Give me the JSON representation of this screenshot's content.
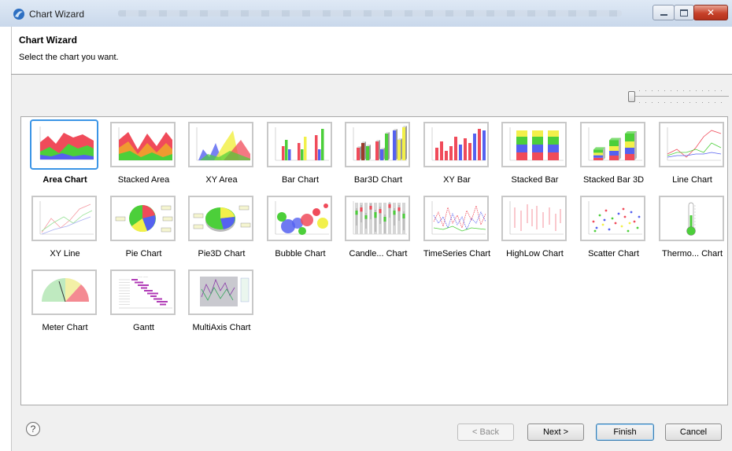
{
  "window": {
    "title": "Chart Wizard"
  },
  "header": {
    "title": "Chart Wizard",
    "subtitle": "Select the chart you want."
  },
  "charts": [
    {
      "label": "Area Chart",
      "selected": true,
      "icon": "area-chart-icon"
    },
    {
      "label": "Stacked Area",
      "icon": "stacked-area-icon"
    },
    {
      "label": "XY Area",
      "icon": "xy-area-icon"
    },
    {
      "label": "Bar Chart",
      "icon": "bar-chart-icon"
    },
    {
      "label": "Bar3D Chart",
      "icon": "bar3d-chart-icon"
    },
    {
      "label": "XY Bar",
      "icon": "xy-bar-icon"
    },
    {
      "label": "Stacked Bar",
      "icon": "stacked-bar-icon"
    },
    {
      "label": "Stacked Bar 3D",
      "icon": "stacked-bar-3d-icon"
    },
    {
      "label": "Line Chart",
      "icon": "line-chart-icon"
    },
    {
      "label": "XY Line",
      "icon": "xy-line-icon"
    },
    {
      "label": "Pie Chart",
      "icon": "pie-chart-icon"
    },
    {
      "label": "Pie3D Chart",
      "icon": "pie3d-chart-icon"
    },
    {
      "label": "Bubble Chart",
      "icon": "bubble-chart-icon"
    },
    {
      "label": "Candle... Chart",
      "icon": "candlestick-chart-icon"
    },
    {
      "label": "TimeSeries Chart",
      "icon": "timeseries-chart-icon"
    },
    {
      "label": "HighLow Chart",
      "icon": "highlow-chart-icon"
    },
    {
      "label": "Scatter Chart",
      "icon": "scatter-chart-icon"
    },
    {
      "label": "Thermo... Chart",
      "icon": "thermometer-chart-icon"
    },
    {
      "label": "Meter Chart",
      "icon": "meter-chart-icon"
    },
    {
      "label": "Gantt",
      "icon": "gantt-chart-icon"
    },
    {
      "label": "MultiAxis Chart",
      "icon": "multiaxis-chart-icon"
    }
  ],
  "footer": {
    "help_symbol": "?",
    "back_label": "< Back",
    "next_label": "Next >",
    "finish_label": "Finish",
    "cancel_label": "Cancel"
  },
  "colors": {
    "selection": "#3b95e6",
    "red": "#f04b5a",
    "green": "#4ccf3a",
    "blue": "#5561f0",
    "yellow": "#f2f04a"
  }
}
